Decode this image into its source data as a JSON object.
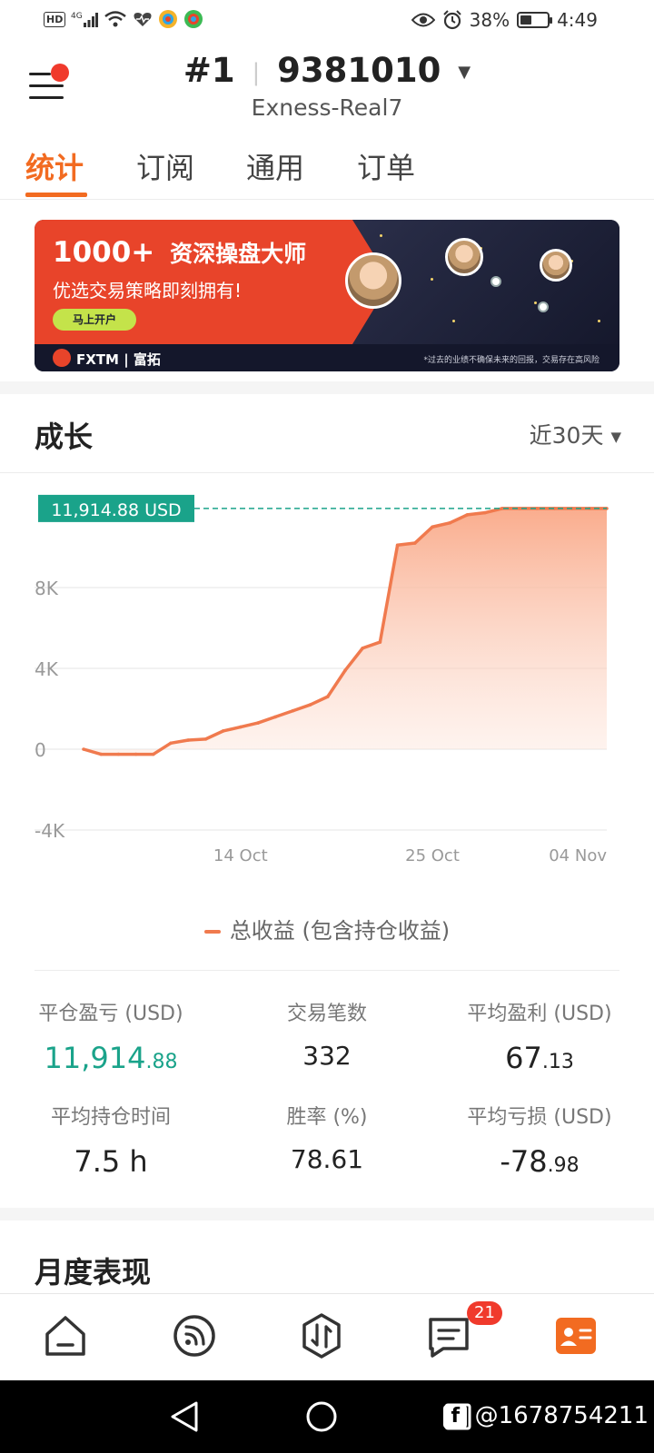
{
  "status_bar": {
    "left": "HD 4G",
    "battery": "38%",
    "battery_level": 0.38,
    "time": "4:49"
  },
  "header": {
    "account_prefix": "#1",
    "account_number": "9381010",
    "server": "Exness-Real7"
  },
  "tabs": [
    {
      "label": "统计",
      "active": true
    },
    {
      "label": "订阅",
      "active": false
    },
    {
      "label": "通用",
      "active": false
    },
    {
      "label": "订单",
      "active": false
    }
  ],
  "banner": {
    "headline_number": "1000+",
    "headline_text": "资深操盘大师",
    "subtitle": "优选交易策略即刻拥有!",
    "button": "马上开户",
    "brand": "FXTM | 富拓",
    "disclaimer": "*过去的业绩不确保未来的回报，交易存在高风险"
  },
  "growth": {
    "title": "成长",
    "range": "近30天"
  },
  "chart_data": {
    "type": "area",
    "x": [
      "Oct 5",
      "Oct 6",
      "Oct 7",
      "Oct 8",
      "Oct 9",
      "Oct 10",
      "Oct 11",
      "Oct 12",
      "Oct 13",
      "Oct 14",
      "Oct 15",
      "Oct 16",
      "Oct 17",
      "Oct 18",
      "Oct 19",
      "Oct 20",
      "Oct 21",
      "Oct 22",
      "Oct 23",
      "Oct 24",
      "Oct 25",
      "Oct 26",
      "Oct 27",
      "Oct 28",
      "Oct 29",
      "Oct 30",
      "Oct 31",
      "Nov 1",
      "Nov 2",
      "Nov 3",
      "Nov 4"
    ],
    "series": [
      {
        "name": "总收益 (包含持仓收益)",
        "values": [
          0,
          -250,
          -250,
          -250,
          -250,
          300,
          450,
          500,
          900,
          1100,
          1300,
          1600,
          1900,
          2200,
          2600,
          3900,
          5000,
          5300,
          10100,
          10200,
          11000,
          11200,
          11600,
          11700,
          11914.88,
          11914.88,
          11914.88,
          11914.88,
          11914.88,
          11914.88,
          11914.88
        ]
      }
    ],
    "yticks": [
      "-4K",
      "0",
      "4K",
      "8K"
    ],
    "ylim": [
      -4000,
      12000
    ],
    "xticks": [
      "14 Oct",
      "25 Oct",
      "04 Nov"
    ],
    "marker_label": "11,914.88 USD",
    "grid": true,
    "color": "#f07a4e"
  },
  "legend": "总收益 (包含持仓收益)",
  "stats": {
    "closed_pnl": {
      "label": "平仓盈亏 (USD)",
      "int": "11,914",
      "dec": ".88"
    },
    "trades": {
      "label": "交易笔数",
      "value": "332"
    },
    "avg_profit": {
      "label": "平均盈利 (USD)",
      "int": "67",
      "dec": ".13"
    },
    "avg_hold": {
      "label": "平均持仓时间",
      "value": "7.5 h"
    },
    "win_rate": {
      "label": "胜率 (%)",
      "value": "78.61"
    },
    "avg_loss": {
      "label": "平均亏损 (USD)",
      "int": "-78",
      "dec": ".98"
    }
  },
  "monthly": {
    "title": "月度表现"
  },
  "bottom_nav": {
    "items": [
      "home-icon",
      "feed-icon",
      "trade-icon",
      "messages-icon",
      "profile-icon"
    ],
    "badge": "21",
    "active_color": "#f26b21"
  },
  "watermark": "@1678754211"
}
